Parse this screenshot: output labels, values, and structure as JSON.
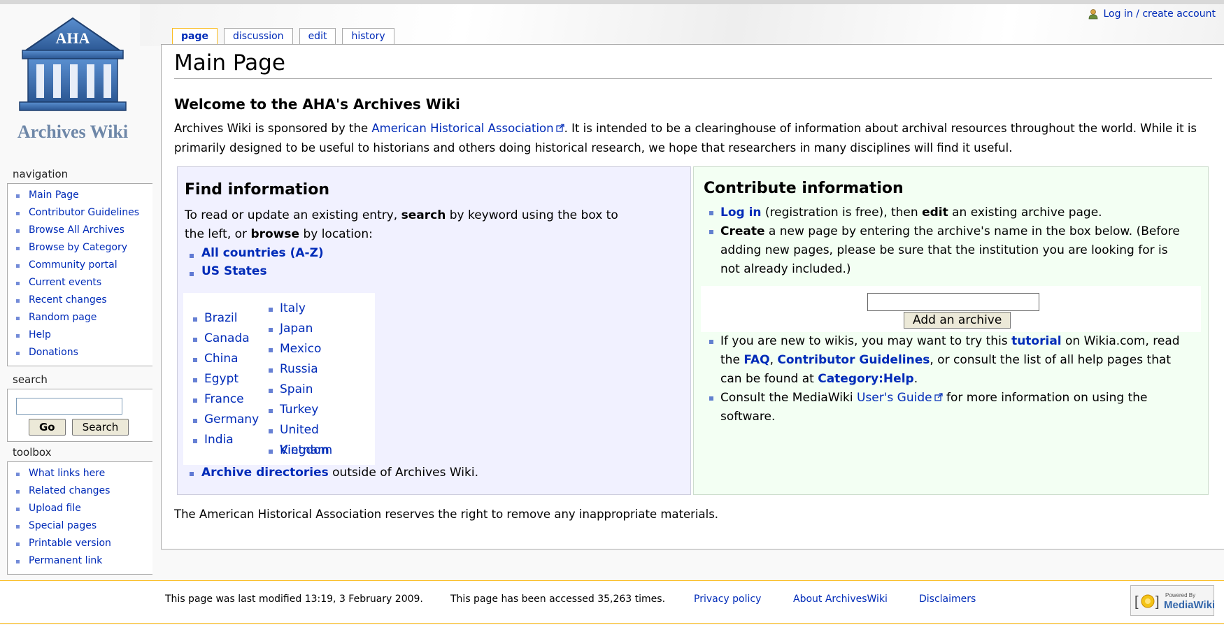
{
  "personal": {
    "login_label": "Log in / create account"
  },
  "logo": {
    "abbr": "AHA",
    "name": "Archives Wiki"
  },
  "navigation": {
    "title": "navigation",
    "items": [
      "Main Page",
      "Contributor Guidelines",
      "Browse All Archives",
      "Browse by Category",
      "Community portal",
      "Current events",
      "Recent changes",
      "Random page",
      "Help",
      "Donations"
    ]
  },
  "search": {
    "title": "search",
    "go_label": "Go",
    "search_label": "Search",
    "value": ""
  },
  "toolbox": {
    "title": "toolbox",
    "items": [
      "What links here",
      "Related changes",
      "Upload file",
      "Special pages",
      "Printable version",
      "Permanent link"
    ]
  },
  "tabs": {
    "page": "page",
    "discussion": "discussion",
    "edit": "edit",
    "history": "history"
  },
  "content": {
    "heading": "Main Page",
    "welcome": "Welcome to the AHA's Archives Wiki",
    "intro_1": "Archives Wiki is sponsored by the ",
    "intro_link": "American Historical Association",
    "intro_2": ". It is intended to be a clearinghouse of information about archival resources throughout the world. While it is primarily designed to be useful to historians and others doing historical research, we hope that researchers in many disciplines will find it useful.",
    "reserves": "The American Historical Association reserves the right to remove any inappropriate materials."
  },
  "find": {
    "title": "Find information",
    "text_1": "To read or update an existing entry, ",
    "search_bold": "search",
    "text_2": " by keyword using the box to the left, or ",
    "browse_bold": "browse",
    "text_3": " by location:",
    "all_countries": "All countries (A-Z)",
    "us_states": "US States",
    "countries_col1": [
      "Brazil",
      "Canada",
      "China",
      "Egypt",
      "France",
      "Germany",
      "India"
    ],
    "countries_col2": [
      "Italy",
      "Japan",
      "Mexico",
      "Russia",
      "Spain",
      "Turkey",
      "United Kingdom",
      "Vietnam"
    ],
    "archive_dirs": "Archive directories",
    "archive_dirs_suffix": " outside of Archives Wiki."
  },
  "contribute": {
    "title": "Contribute information",
    "b1_login": "Log in",
    "b1_text": " (registration is free), then ",
    "b1_edit": "edit",
    "b1_rest": " an existing archive page.",
    "b2_create": "Create",
    "b2_rest": " a new page by entering the archive's name in the box below. (Before adding new pages, please be sure that the institution you are looking for is not already included.)",
    "add_button": "Add an archive",
    "archive_input_value": "",
    "b3_text1": "If you are new to wikis, you may want to try this ",
    "b3_tutorial": "tutorial",
    "b3_text2": " on Wikia.com, read the ",
    "b3_faq": "FAQ",
    "b3_comma": ", ",
    "b3_guidelines": "Contributor Guidelines",
    "b3_text3": ", or consult the list of all help pages that can be found at ",
    "b3_category": "Category:Help",
    "b3_end": ".",
    "b4_text1": "Consult the MediaWiki ",
    "b4_link": "User's Guide",
    "b4_text2": " for more information on using the software."
  },
  "footer": {
    "lastmod": "This page was last modified 13:19, 3 February 2009.",
    "viewcount": "This page has been accessed 35,263 times.",
    "privacy": "Privacy policy",
    "about": "About ArchivesWiki",
    "disclaimers": "Disclaimers",
    "powered_by": "Powered By",
    "mediawiki": "MediaWiki"
  },
  "colors": {
    "link": "#002bb8",
    "find_bg": "#f1f1ff",
    "contrib_bg": "#f3fff3",
    "tab_selected_border": "#fabd23",
    "footer_border": "#fabd23",
    "logo_blue": "#3a6ea8"
  }
}
